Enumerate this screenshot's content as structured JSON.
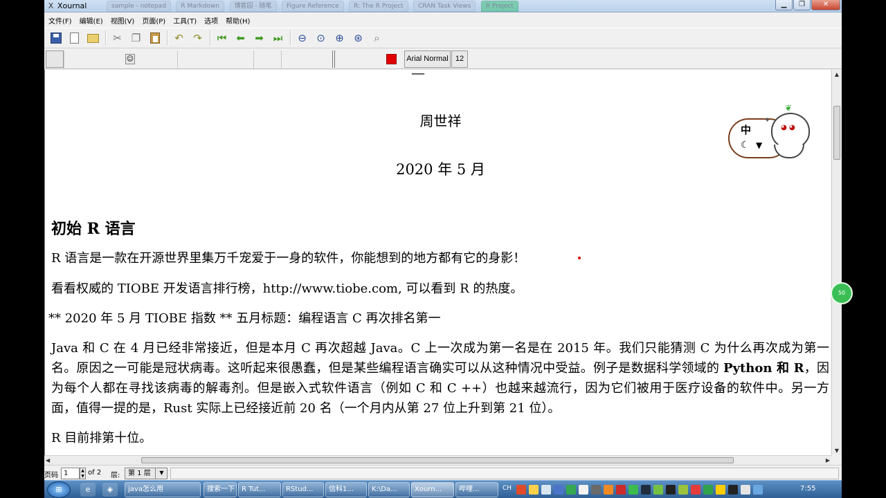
{
  "window": {
    "title": "Xournal",
    "ghost_tabs": [
      "sample - notepad",
      "R Markdown",
      "博客园 - 随笔",
      "Figure Reference",
      "R: The R Project",
      "CRAN Task Views",
      "R Project"
    ]
  },
  "menu": [
    "文件(F)",
    "编辑(E)",
    "视图(V)",
    "页面(P)",
    "工具(T)",
    "选项",
    "帮助(H)"
  ],
  "toolbar2": {
    "font_name": "Arial Normal",
    "font_size": "12",
    "pen_color": "#e00000"
  },
  "document": {
    "author": "周世祥",
    "date": "2020 年 5 月",
    "heading": "初始 R 语言",
    "p1": "R 语言是一款在开源世界里集万千宠爱于一身的软件，你能想到的地方都有它的身影！",
    "p2": "看看权威的 TIOBE 开发语言排行榜，http://www.tiobe.com, 可以看到 R 的热度。",
    "p3": "** 2020 年 5 月 TIOBE 指数 ** 五月标题：编程语言 C 再次排名第一",
    "p4_before": "Java 和 C 在 4 月已经非常接近，但是本月 C 再次超越 Java。C 上一次成为第一名是在 2015 年。我们只能猜测 C 为什么再次成为第一名。原因之一可能是冠状病毒。这听起来很愚蠢，但是某些编程语言确实可以从这种情况中受益。例子是数据科学领域的 ",
    "p4_bold": "Python 和 R",
    "p4_after": "，因为每个人都在寻找该病毒的解毒剂。但是嵌入式软件语言（例如 C 和 C ++）也越来越流行，因为它们被用于医疗设备的软件中。另一方面，值得一提的是，Rust 实际上已经接近前 20 名（一个月内从第 27 位上升到第 21 位）。",
    "p5": "R 目前排第十位。"
  },
  "sticker": {
    "char": "中"
  },
  "status": {
    "page_label": "页码",
    "page_value": "1",
    "page_total": "of 2",
    "layer_label": "层:",
    "layer_value": "第 1 层"
  },
  "taskbar": {
    "tasks": [
      "java怎么用",
      "搜索一下",
      "R Tut...",
      "RStud...",
      "信科1...",
      "K:\\Da...",
      "Xourn...",
      "哔哩..."
    ],
    "ime": "CH",
    "clock": "7:55",
    "badge": "50"
  }
}
